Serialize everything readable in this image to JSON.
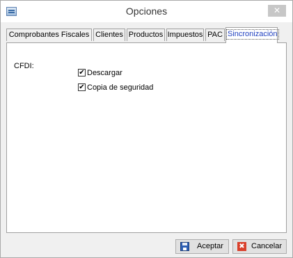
{
  "window": {
    "title": "Opciones"
  },
  "titlebar": {
    "close_glyph": "✕",
    "app_icon": "form-icon",
    "close_icon": "close-icon"
  },
  "tabs": [
    {
      "label": "Comprobantes Fiscales",
      "active": false
    },
    {
      "label": "Clientes",
      "active": false
    },
    {
      "label": "Productos",
      "active": false
    },
    {
      "label": "Impuestos",
      "active": false
    },
    {
      "label": "PAC",
      "active": false
    },
    {
      "label": "Sincronización",
      "active": true
    }
  ],
  "panel": {
    "section_label": "CFDI:",
    "options": [
      {
        "label": "Descargar",
        "checked": true,
        "check_glyph": "✔"
      },
      {
        "label": "Copia de seguridad",
        "checked": true,
        "check_glyph": "✔"
      }
    ]
  },
  "buttons": {
    "accept": {
      "label": "Aceptar",
      "icon": "save-icon"
    },
    "cancel": {
      "label": "Cancelar",
      "icon": "cancel-icon",
      "icon_glyph": "✖"
    }
  },
  "colors": {
    "active_tab_text": "#1f3fbf",
    "cancel_icon": "#d9402b",
    "save_icon": "#2d5fb4"
  }
}
